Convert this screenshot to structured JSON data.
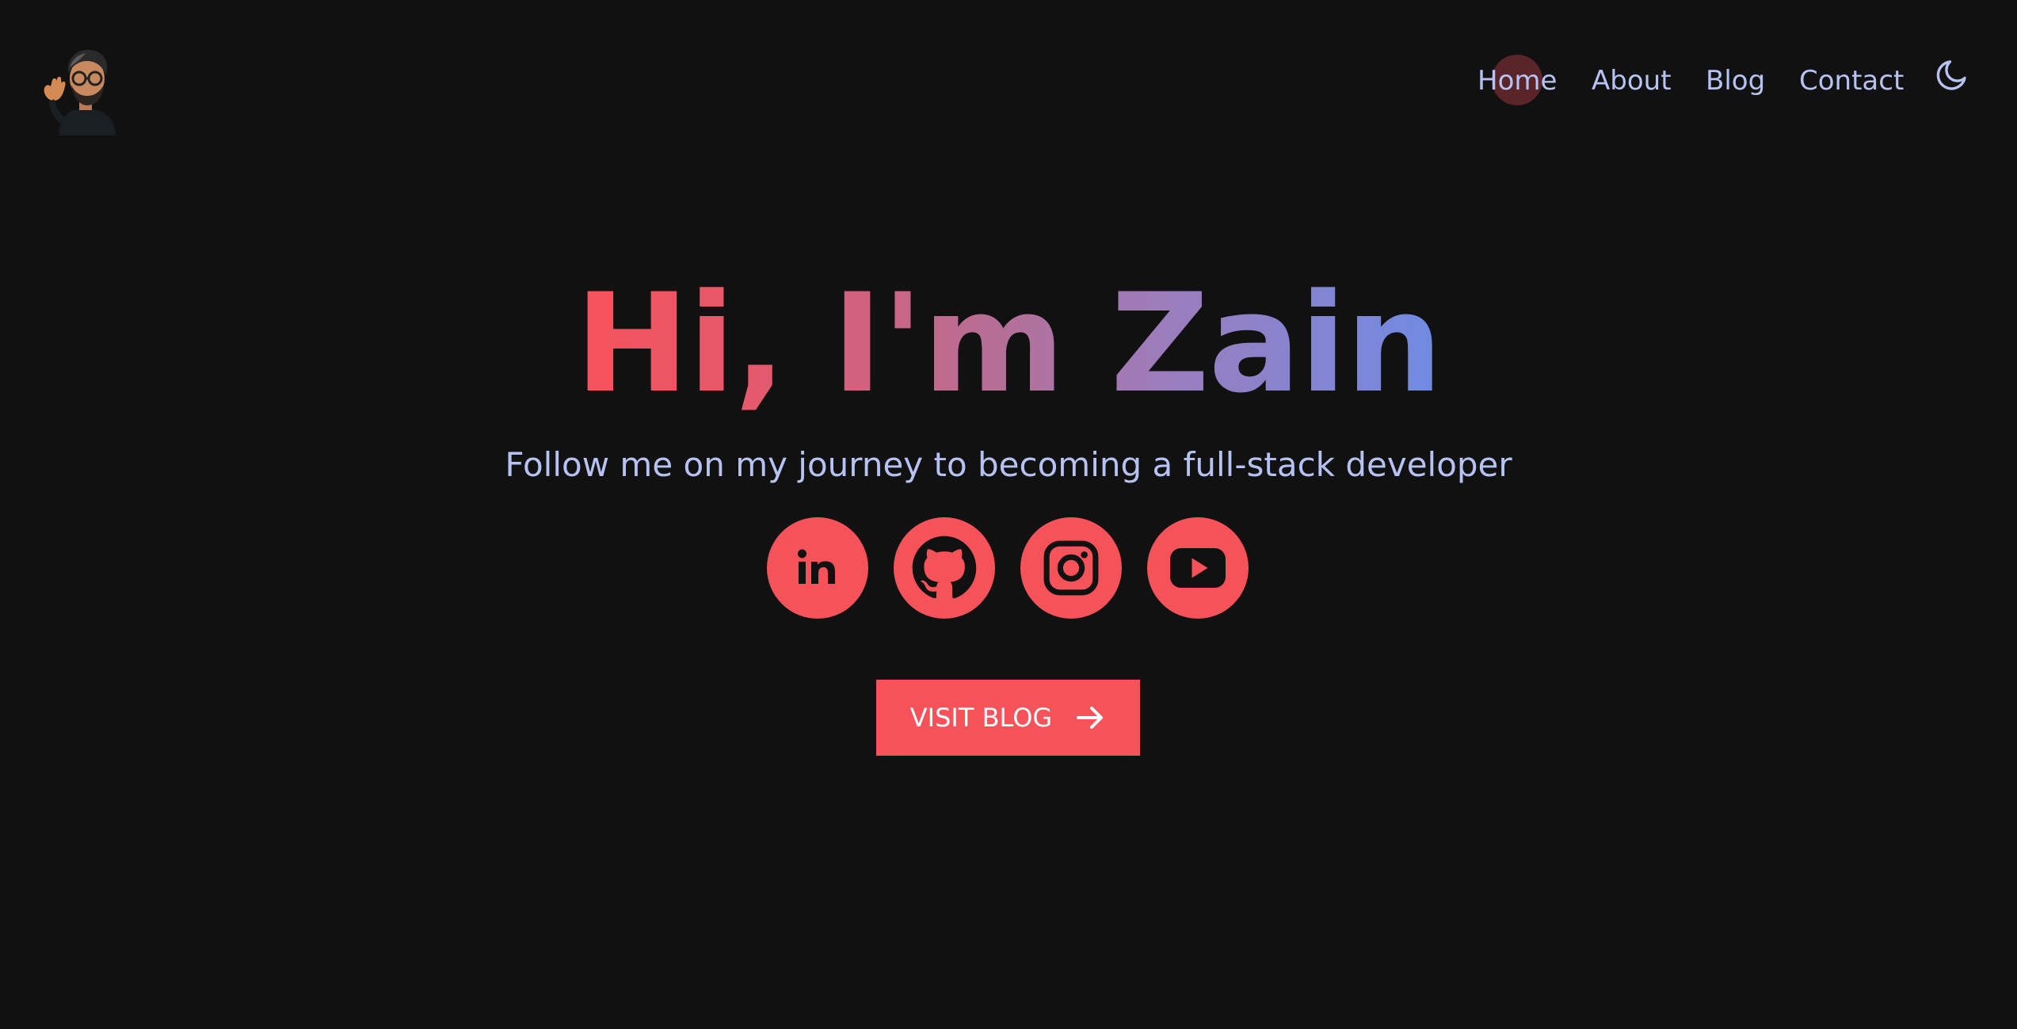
{
  "header": {
    "logo": "memoji-avatar-waving",
    "nav": [
      {
        "label": "Home"
      },
      {
        "label": "About"
      },
      {
        "label": "Blog"
      },
      {
        "label": "Contact"
      }
    ],
    "theme_toggle_icon": "moon-icon"
  },
  "hero": {
    "title": "Hi, I'm Zain",
    "subtitle": "Follow me on my journey to becoming a full-stack developer",
    "socials": [
      {
        "icon": "linkedin-icon"
      },
      {
        "icon": "github-icon"
      },
      {
        "icon": "instagram-icon"
      },
      {
        "icon": "youtube-icon"
      }
    ],
    "cta_label": "VISIT BLOG",
    "cta_icon": "arrow-right-icon"
  },
  "colors": {
    "background": "#111112",
    "accent": "#f6525a",
    "nav_text": "#b6c3f2",
    "gradient_start": "#f6525a",
    "gradient_end": "#6f8be3"
  }
}
